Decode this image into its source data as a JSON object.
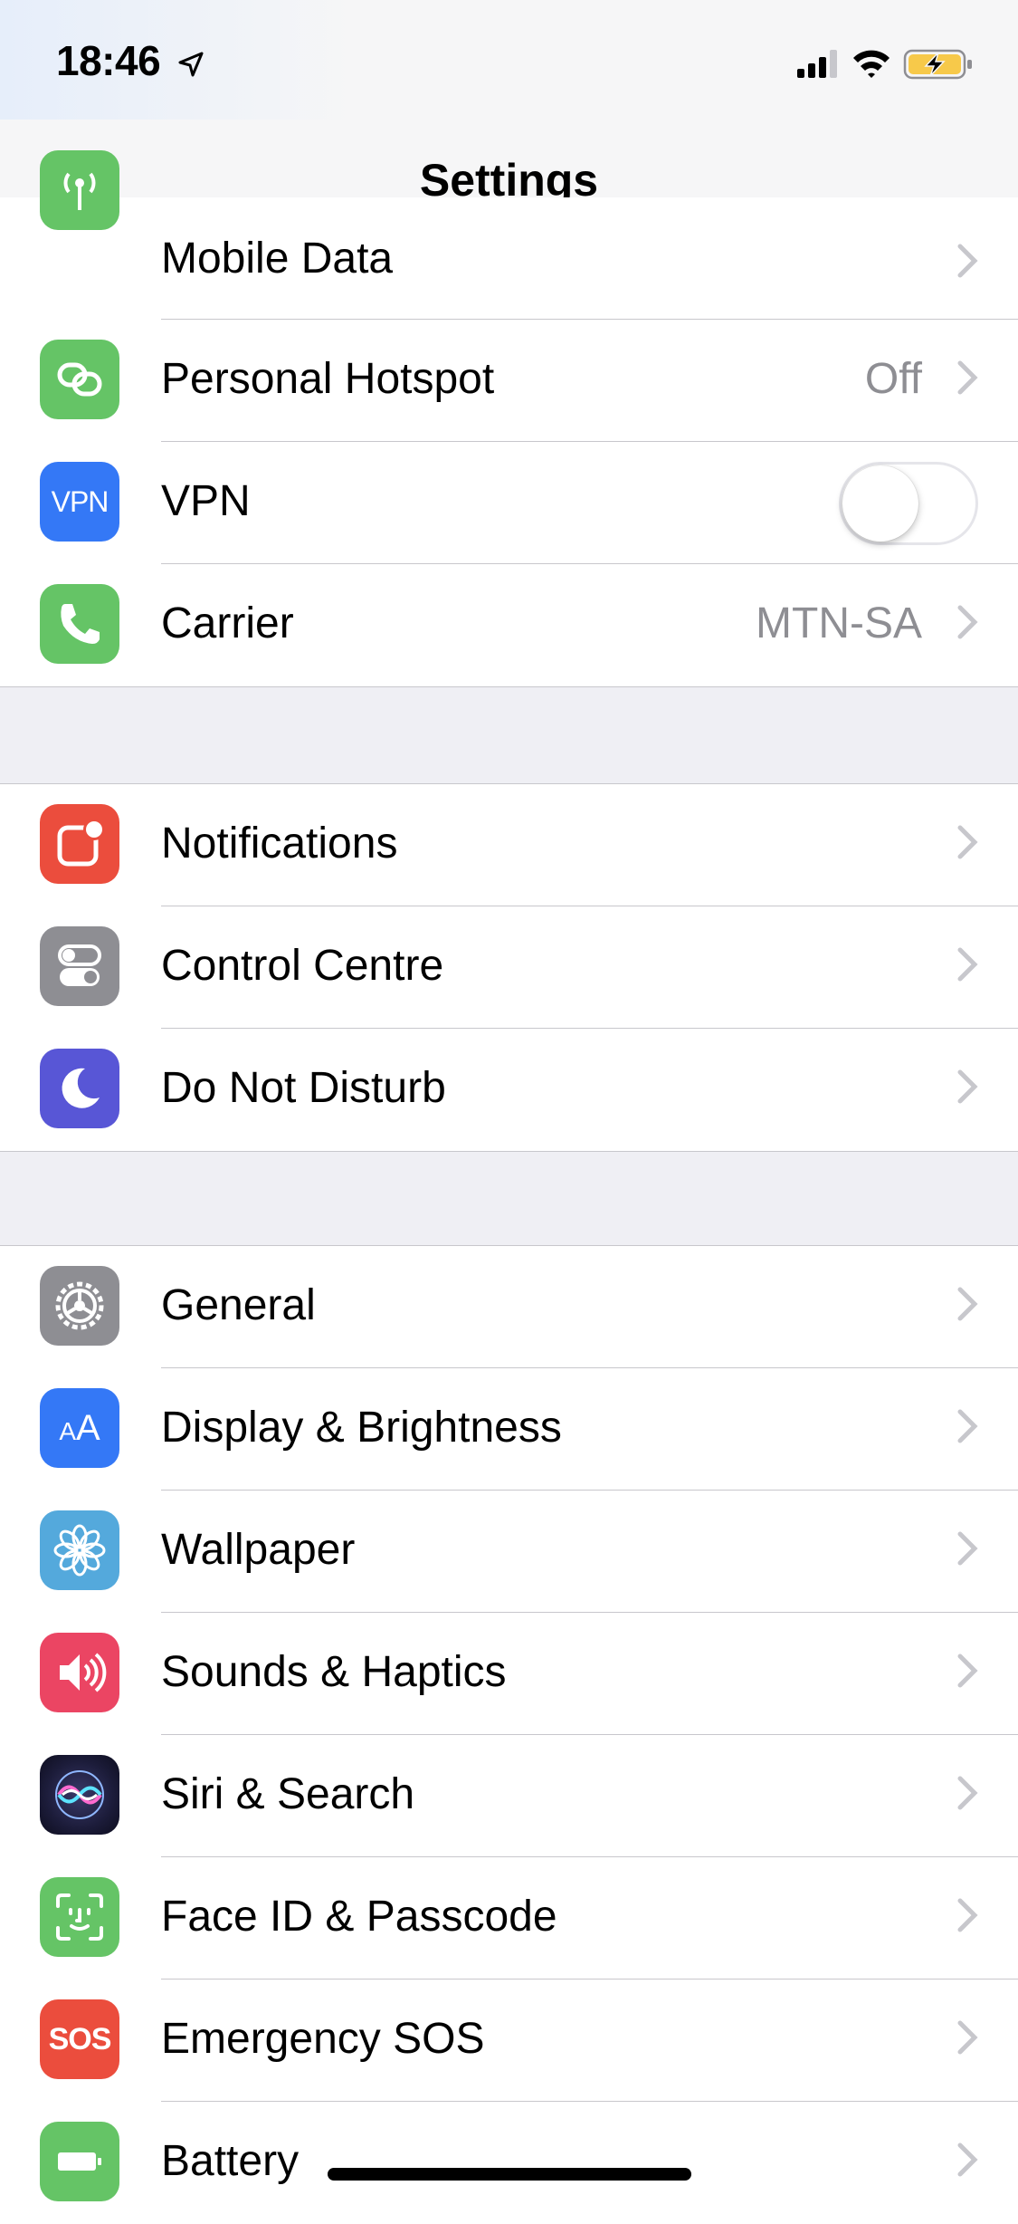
{
  "status": {
    "time": "18:46"
  },
  "nav": {
    "title": "Settings"
  },
  "section1": [
    {
      "label": "Mobile Data",
      "icon": "antenna-icon",
      "color": "#65c466",
      "value": ""
    },
    {
      "label": "Personal Hotspot",
      "icon": "hotspot-icon",
      "color": "#65c466",
      "value": "Off"
    },
    {
      "label": "VPN",
      "icon": "vpn-icon",
      "color": "#3478f6",
      "value": "",
      "toggle": false,
      "icon_text": "VPN"
    },
    {
      "label": "Carrier",
      "icon": "phone-icon",
      "color": "#65c466",
      "value": "MTN-SA"
    }
  ],
  "section2": [
    {
      "label": "Notifications",
      "icon": "notifications-icon",
      "color": "#eb4d3d"
    },
    {
      "label": "Control Centre",
      "icon": "switches-icon",
      "color": "#8e8e93"
    },
    {
      "label": "Do Not Disturb",
      "icon": "moon-icon",
      "color": "#5856d6"
    }
  ],
  "section3": [
    {
      "label": "General",
      "icon": "gear-icon",
      "color": "#8e8e93"
    },
    {
      "label": "Display & Brightness",
      "icon": "text-size-icon",
      "color": "#3478f6",
      "icon_text": "AA"
    },
    {
      "label": "Wallpaper",
      "icon": "flower-icon",
      "color": "#54a9dc"
    },
    {
      "label": "Sounds & Haptics",
      "icon": "speaker-icon",
      "color": "#eb4563"
    },
    {
      "label": "Siri & Search",
      "icon": "siri-icon",
      "color": "#1c1c3a"
    },
    {
      "label": "Face ID & Passcode",
      "icon": "face-id-icon",
      "color": "#65c466"
    },
    {
      "label": "Emergency SOS",
      "icon": "sos-icon",
      "color": "#eb4d3d",
      "icon_text": "SOS"
    },
    {
      "label": "Battery",
      "icon": "battery-icon",
      "color": "#65c466"
    }
  ]
}
